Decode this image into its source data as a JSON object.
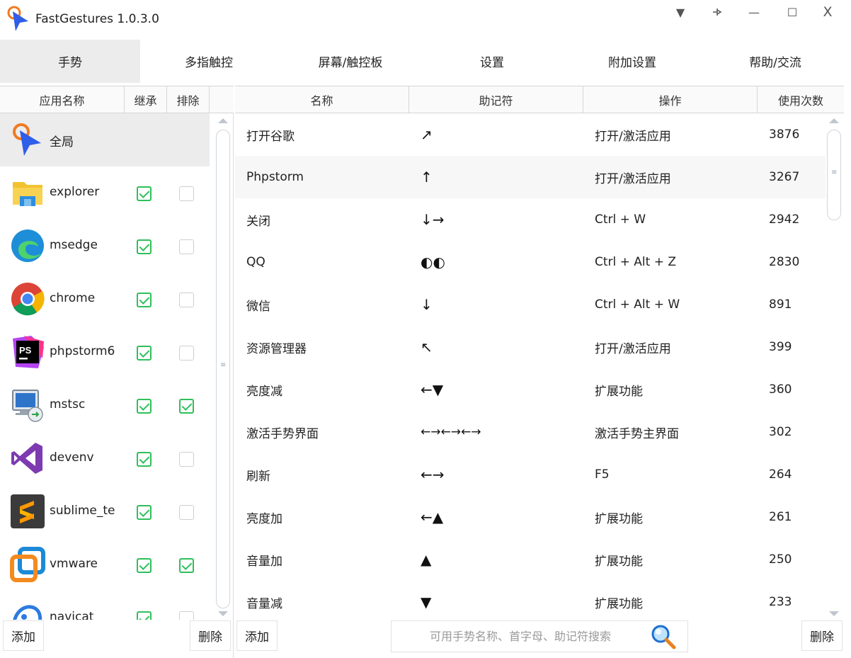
{
  "app": {
    "title": "FastGestures 1.0.3.0"
  },
  "window_controls": {
    "dropdown_icon": "▼",
    "pin_icon": "⊣",
    "minimize_icon": "—",
    "maximize_icon": "☐",
    "close_icon": "X"
  },
  "tabs": [
    {
      "label": "手势",
      "active": true
    },
    {
      "label": "多指触控",
      "active": false
    },
    {
      "label": "屏幕/触控板",
      "active": false
    },
    {
      "label": "设置",
      "active": false
    },
    {
      "label": "附加设置",
      "active": false
    },
    {
      "label": "帮助/交流",
      "active": false
    }
  ],
  "left_panel": {
    "headers": {
      "name": "应用名称",
      "inherit": "继承",
      "exclude": "排除"
    },
    "apps": [
      {
        "name": "全局",
        "icon": "fastgestures-logo-icon",
        "inherit": null,
        "exclude": null,
        "selected": true
      },
      {
        "name": "explorer",
        "icon": "folder-icon",
        "inherit": true,
        "exclude": false
      },
      {
        "name": "msedge",
        "icon": "edge-icon",
        "inherit": true,
        "exclude": false
      },
      {
        "name": "chrome",
        "icon": "chrome-icon",
        "inherit": true,
        "exclude": false
      },
      {
        "name": "phpstorm6",
        "icon": "phpstorm-icon",
        "inherit": true,
        "exclude": false
      },
      {
        "name": "mstsc",
        "icon": "remote-desktop-icon",
        "inherit": true,
        "exclude": true
      },
      {
        "name": "devenv",
        "icon": "visual-studio-icon",
        "inherit": true,
        "exclude": false
      },
      {
        "name": "sublime_text",
        "icon": "sublime-icon",
        "inherit": true,
        "exclude": false
      },
      {
        "name": "vmware",
        "icon": "vmware-icon",
        "inherit": true,
        "exclude": true
      },
      {
        "name": "navicat",
        "icon": "navicat-icon",
        "inherit": true,
        "exclude": false
      }
    ],
    "add_label": "添加",
    "delete_label": "删除"
  },
  "right_panel": {
    "headers": {
      "name": "名称",
      "mnemonic": "助记符",
      "action": "操作",
      "count": "使用次数"
    },
    "gestures": [
      {
        "name": "打开谷歌",
        "mnemonic": "↗",
        "action": "打开/激活应用",
        "count": "3876"
      },
      {
        "name": "Phpstorm",
        "mnemonic": "↑",
        "action": "打开/激活应用",
        "count": "3267"
      },
      {
        "name": "关闭",
        "mnemonic": "↓→",
        "action": "Ctrl + W",
        "count": "2942"
      },
      {
        "name": "QQ",
        "mnemonic": "◐◐",
        "action": "Ctrl + Alt + Z",
        "count": "2830"
      },
      {
        "name": "微信",
        "mnemonic": "↓",
        "action": "Ctrl + Alt + W",
        "count": "891"
      },
      {
        "name": "资源管理器",
        "mnemonic": "↖",
        "action": "打开/激活应用",
        "count": "399"
      },
      {
        "name": "亮度减",
        "mnemonic": "←▼",
        "action": "扩展功能",
        "count": "360"
      },
      {
        "name": "激活手势界面",
        "mnemonic": "←→←→←→",
        "action": "激活手势主界面",
        "count": "302"
      },
      {
        "name": "刷新",
        "mnemonic": "←→",
        "action": "F5",
        "count": "264"
      },
      {
        "name": "亮度加",
        "mnemonic": "←▲",
        "action": "扩展功能",
        "count": "261"
      },
      {
        "name": "音量加",
        "mnemonic": "▲",
        "action": "扩展功能",
        "count": "250"
      },
      {
        "name": "音量减",
        "mnemonic": "▼",
        "action": "扩展功能",
        "count": "233"
      }
    ],
    "add_label": "添加",
    "delete_label": "删除",
    "search_placeholder": "可用手势名称、首字母、助记符搜索"
  },
  "colors": {
    "accent_green": "#2fbf5a",
    "active_tab_bg": "#ececec",
    "border": "#d6d6d6"
  }
}
